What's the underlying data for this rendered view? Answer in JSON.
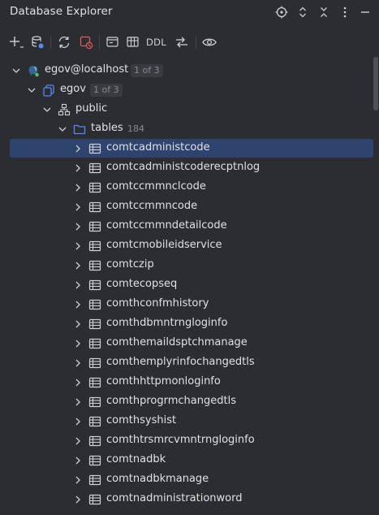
{
  "header": {
    "title": "Database Explorer",
    "icons": [
      "crosshair-icon",
      "expand-collapse-icon",
      "collapse-all-icon",
      "more-vertical-icon",
      "minimize-icon"
    ]
  },
  "toolbar": {
    "items": [
      "add-icon",
      "data-source-properties-icon",
      "refresh-icon",
      "disconnect-icon",
      "console-icon",
      "table-view-icon",
      "ddl",
      "jump-icon",
      "view-options-icon"
    ],
    "ddl_label": "DDL"
  },
  "tree": {
    "root": {
      "label": "egov@localhost",
      "badge": "1 of 3"
    },
    "database": {
      "label": "egov",
      "badge": "1 of 3"
    },
    "schema": {
      "label": "public"
    },
    "tables_folder": {
      "label": "tables",
      "count": "184"
    },
    "tables": [
      "comtcadministcode",
      "comtcadministcoderecptnlog",
      "comtccmmnclcode",
      "comtccmmncode",
      "comtccmmndetailcode",
      "comtcmobileidservice",
      "comtczip",
      "comtecopseq",
      "comthconfmhistory",
      "comthdbmntrngloginfo",
      "comthemaildsptchmanage",
      "comthemplyrinfochangedtls",
      "comthhttpmonloginfo",
      "comthprogrmchangedtls",
      "comthsyshist",
      "comthtrsmrcvmntrngloginfo",
      "comtnadbk",
      "comtnadbkmanage",
      "comtnadministrationword"
    ],
    "selected_index": 0
  },
  "colors": {
    "background": "#2b2d30",
    "selection": "#2e436e",
    "text": "#dfe1e5",
    "muted": "#868a91",
    "folder": "#548af7",
    "postgres": "#336791"
  }
}
